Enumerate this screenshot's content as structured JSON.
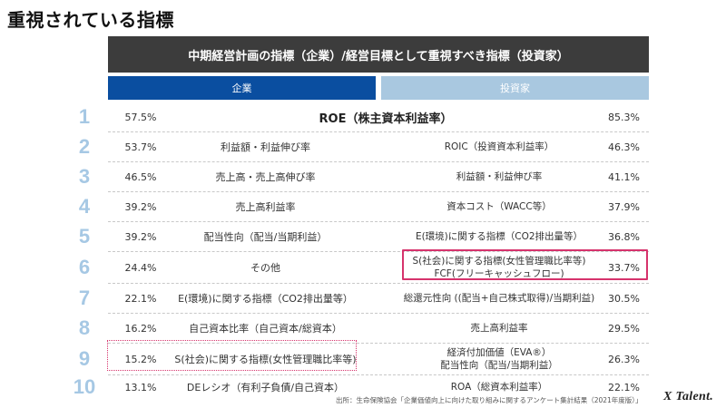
{
  "page_title": "重視されている指標",
  "header": "中期経営計画の指標（企業）/経営目標として重視すべき指標（投資家）",
  "columns": {
    "corporate": "企業",
    "investor": "投資家"
  },
  "rows": [
    {
      "rank": "1",
      "corp_pct": "57.5%",
      "merged_item": "ROE（株主資本利益率）",
      "inv_pct": "85.3%"
    },
    {
      "rank": "2",
      "corp_pct": "53.7%",
      "corp_item": "利益額・利益伸び率",
      "inv_item": "ROIC（投資資本利益率）",
      "inv_pct": "46.3%"
    },
    {
      "rank": "3",
      "corp_pct": "46.5%",
      "corp_item": "売上高・売上高伸び率",
      "inv_item": "利益額・利益伸び率",
      "inv_pct": "41.1%"
    },
    {
      "rank": "4",
      "corp_pct": "39.2%",
      "corp_item": "売上高利益率",
      "inv_item": "資本コスト（WACC等）",
      "inv_pct": "37.9%"
    },
    {
      "rank": "5",
      "corp_pct": "39.2%",
      "corp_item": "配当性向（配当/当期利益）",
      "inv_item": "E(環境)に関する指標（CO2排出量等）",
      "inv_pct": "36.8%"
    },
    {
      "rank": "6",
      "corp_pct": "24.4%",
      "corp_item": "その他",
      "inv_item": "S(社会)に関する指標(女性管理職比率等)",
      "inv_item_2": "FCF(フリーキャッシュフロー)",
      "inv_pct": "33.7%"
    },
    {
      "rank": "7",
      "corp_pct": "22.1%",
      "corp_item": "E(環境)に関する指標（CO2排出量等）",
      "inv_item": "総還元性向 ((配当+自己株式取得)/当期利益)",
      "inv_pct": "30.5%"
    },
    {
      "rank": "8",
      "corp_pct": "16.2%",
      "corp_item": "自己資本比率（自己資本/総資本）",
      "inv_item": "売上高利益率",
      "inv_pct": "29.5%"
    },
    {
      "rank": "9",
      "corp_pct": "15.2%",
      "corp_item": "S(社会)に関する指標(女性管理職比率等)",
      "inv_item": "経済付加価値（EVA®）",
      "inv_item_2": "配当性向（配当/当期利益）",
      "inv_pct": "26.3%"
    },
    {
      "rank": "10",
      "corp_pct": "13.1%",
      "corp_item": "DEレシオ（有利子負債/自己資本）",
      "inv_item": "ROA（総資本利益率）",
      "inv_pct": "22.1%"
    }
  ],
  "source": "出所：生命保険協会「企業価値向上に向けた取り組みに関するアンケート集計結果（2021年度版）」",
  "logo": "X Talent.",
  "colors": {
    "header_bg": "#3c3c3c",
    "corporate_head": "#0a4ea0",
    "investor_head": "#a9c8e0",
    "rank_number": "#a6c8e4",
    "highlight": "#d6336c"
  }
}
